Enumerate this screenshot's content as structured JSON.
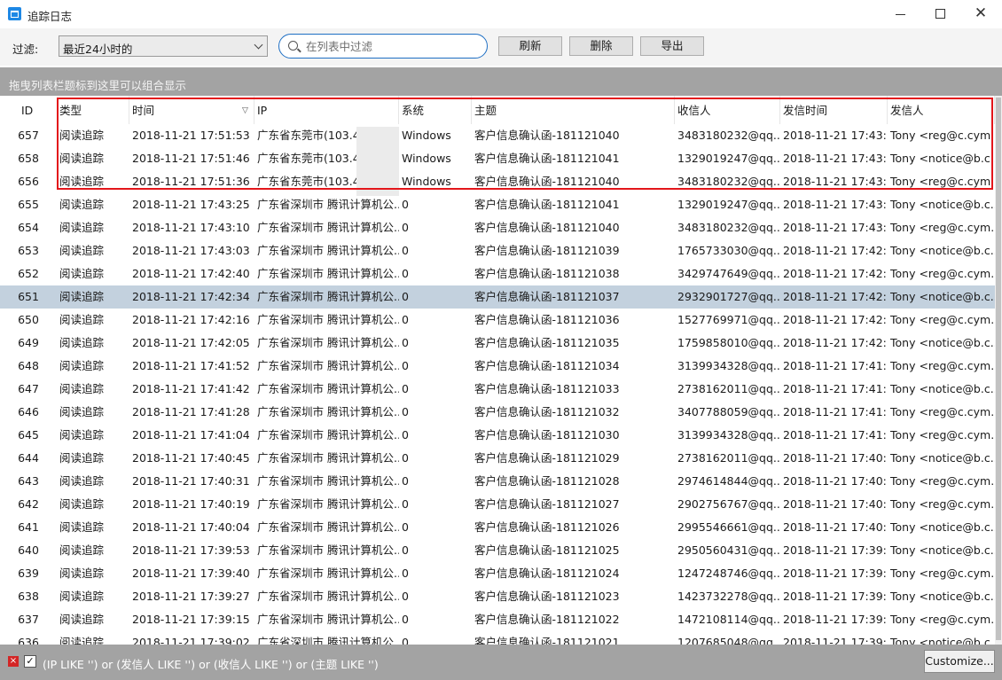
{
  "window": {
    "title": "追踪日志",
    "minimize": "—",
    "maximize": "☐",
    "close": "✕"
  },
  "toolbar": {
    "filter_label": "过滤:",
    "filter_value": "最近24小时的",
    "search_placeholder": "在列表中过滤",
    "refresh": "刷新",
    "delete": "删除",
    "export": "导出"
  },
  "group_panel": {
    "hint": "拖曳列表栏题标到这里可以组合显示"
  },
  "columns": {
    "id": "ID",
    "type": "类型",
    "time": "时间",
    "ip": "IP",
    "system": "系统",
    "subject": "主题",
    "recipient": "收信人",
    "send_time": "发信时间",
    "sender": "发信人"
  },
  "sort_indicator": "▽",
  "selected_row_id": "651",
  "rows": [
    {
      "id": "657",
      "type": "阅读追踪",
      "time": "2018-11-21 17:51:53",
      "ip": "广东省东莞市(103.45",
      "system": "Windows",
      "subject": "客户信息确认函-181121040",
      "recipient": "3483180232@qq....",
      "send_time": "2018-11-21 17:43:...",
      "sender": "Tony <reg@c.cym..."
    },
    {
      "id": "658",
      "type": "阅读追踪",
      "time": "2018-11-21 17:51:46",
      "ip": "广东省东莞市(103.45",
      "system": "Windows",
      "subject": "客户信息确认函-181121041",
      "recipient": "1329019247@qq....",
      "send_time": "2018-11-21 17:43:...",
      "sender": "Tony <notice@b.c..."
    },
    {
      "id": "656",
      "type": "阅读追踪",
      "time": "2018-11-21 17:51:36",
      "ip": "广东省东莞市(103.45",
      "system": "Windows",
      "subject": "客户信息确认函-181121040",
      "recipient": "3483180232@qq....",
      "send_time": "2018-11-21 17:43:...",
      "sender": "Tony <reg@c.cym..."
    },
    {
      "id": "655",
      "type": "阅读追踪",
      "time": "2018-11-21 17:43:25",
      "ip": "广东省深圳市 腾讯计算机公...",
      "system": "0",
      "subject": "客户信息确认函-181121041",
      "recipient": "1329019247@qq....",
      "send_time": "2018-11-21 17:43:...",
      "sender": "Tony <notice@b.c..."
    },
    {
      "id": "654",
      "type": "阅读追踪",
      "time": "2018-11-21 17:43:10",
      "ip": "广东省深圳市 腾讯计算机公...",
      "system": "0",
      "subject": "客户信息确认函-181121040",
      "recipient": "3483180232@qq....",
      "send_time": "2018-11-21 17:43:...",
      "sender": "Tony <reg@c.cym..."
    },
    {
      "id": "653",
      "type": "阅读追踪",
      "time": "2018-11-21 17:43:03",
      "ip": "广东省深圳市 腾讯计算机公...",
      "system": "0",
      "subject": "客户信息确认函-181121039",
      "recipient": "1765733030@qq....",
      "send_time": "2018-11-21 17:42:...",
      "sender": "Tony <notice@b.c..."
    },
    {
      "id": "652",
      "type": "阅读追踪",
      "time": "2018-11-21 17:42:40",
      "ip": "广东省深圳市 腾讯计算机公...",
      "system": "0",
      "subject": "客户信息确认函-181121038",
      "recipient": "3429747649@qq....",
      "send_time": "2018-11-21 17:42:...",
      "sender": "Tony <reg@c.cym..."
    },
    {
      "id": "651",
      "type": "阅读追踪",
      "time": "2018-11-21 17:42:34",
      "ip": "广东省深圳市 腾讯计算机公...",
      "system": "0",
      "subject": "客户信息确认函-181121037",
      "recipient": "2932901727@qq....",
      "send_time": "2018-11-21 17:42:...",
      "sender": "Tony <notice@b.c..."
    },
    {
      "id": "650",
      "type": "阅读追踪",
      "time": "2018-11-21 17:42:16",
      "ip": "广东省深圳市 腾讯计算机公...",
      "system": "0",
      "subject": "客户信息确认函-181121036",
      "recipient": "1527769971@qq....",
      "send_time": "2018-11-21 17:42:...",
      "sender": "Tony <reg@c.cym..."
    },
    {
      "id": "649",
      "type": "阅读追踪",
      "time": "2018-11-21 17:42:05",
      "ip": "广东省深圳市 腾讯计算机公...",
      "system": "0",
      "subject": "客户信息确认函-181121035",
      "recipient": "1759858010@qq....",
      "send_time": "2018-11-21 17:42:...",
      "sender": "Tony <notice@b.c..."
    },
    {
      "id": "648",
      "type": "阅读追踪",
      "time": "2018-11-21 17:41:52",
      "ip": "广东省深圳市 腾讯计算机公...",
      "system": "0",
      "subject": "客户信息确认函-181121034",
      "recipient": "3139934328@qq....",
      "send_time": "2018-11-21 17:41:...",
      "sender": "Tony <reg@c.cym..."
    },
    {
      "id": "647",
      "type": "阅读追踪",
      "time": "2018-11-21 17:41:42",
      "ip": "广东省深圳市 腾讯计算机公...",
      "system": "0",
      "subject": "客户信息确认函-181121033",
      "recipient": "2738162011@qq....",
      "send_time": "2018-11-21 17:41:...",
      "sender": "Tony <notice@b.c..."
    },
    {
      "id": "646",
      "type": "阅读追踪",
      "time": "2018-11-21 17:41:28",
      "ip": "广东省深圳市 腾讯计算机公...",
      "system": "0",
      "subject": "客户信息确认函-181121032",
      "recipient": "3407788059@qq....",
      "send_time": "2018-11-21 17:41:...",
      "sender": "Tony <reg@c.cym..."
    },
    {
      "id": "645",
      "type": "阅读追踪",
      "time": "2018-11-21 17:41:04",
      "ip": "广东省深圳市 腾讯计算机公...",
      "system": "0",
      "subject": "客户信息确认函-181121030",
      "recipient": "3139934328@qq....",
      "send_time": "2018-11-21 17:41:...",
      "sender": "Tony <reg@c.cym..."
    },
    {
      "id": "644",
      "type": "阅读追踪",
      "time": "2018-11-21 17:40:45",
      "ip": "广东省深圳市 腾讯计算机公...",
      "system": "0",
      "subject": "客户信息确认函-181121029",
      "recipient": "2738162011@qq....",
      "send_time": "2018-11-21 17:40:...",
      "sender": "Tony <notice@b.c..."
    },
    {
      "id": "643",
      "type": "阅读追踪",
      "time": "2018-11-21 17:40:31",
      "ip": "广东省深圳市 腾讯计算机公...",
      "system": "0",
      "subject": "客户信息确认函-181121028",
      "recipient": "2974614844@qq....",
      "send_time": "2018-11-21 17:40:...",
      "sender": "Tony <reg@c.cym..."
    },
    {
      "id": "642",
      "type": "阅读追踪",
      "time": "2018-11-21 17:40:19",
      "ip": "广东省深圳市 腾讯计算机公...",
      "system": "0",
      "subject": "客户信息确认函-181121027",
      "recipient": "2902756767@qq....",
      "send_time": "2018-11-21 17:40:...",
      "sender": "Tony <reg@c.cym..."
    },
    {
      "id": "641",
      "type": "阅读追踪",
      "time": "2018-11-21 17:40:04",
      "ip": "广东省深圳市 腾讯计算机公...",
      "system": "0",
      "subject": "客户信息确认函-181121026",
      "recipient": "2995546661@qq....",
      "send_time": "2018-11-21 17:40:...",
      "sender": "Tony <notice@b.c..."
    },
    {
      "id": "640",
      "type": "阅读追踪",
      "time": "2018-11-21 17:39:53",
      "ip": "广东省深圳市 腾讯计算机公...",
      "system": "0",
      "subject": "客户信息确认函-181121025",
      "recipient": "2950560431@qq....",
      "send_time": "2018-11-21 17:39:...",
      "sender": "Tony <notice@b.c..."
    },
    {
      "id": "639",
      "type": "阅读追踪",
      "time": "2018-11-21 17:39:40",
      "ip": "广东省深圳市 腾讯计算机公...",
      "system": "0",
      "subject": "客户信息确认函-181121024",
      "recipient": "1247248746@qq....",
      "send_time": "2018-11-21 17:39:...",
      "sender": "Tony <reg@c.cym..."
    },
    {
      "id": "638",
      "type": "阅读追踪",
      "time": "2018-11-21 17:39:27",
      "ip": "广东省深圳市 腾讯计算机公...",
      "system": "0",
      "subject": "客户信息确认函-181121023",
      "recipient": "1423732278@qq....",
      "send_time": "2018-11-21 17:39:...",
      "sender": "Tony <notice@b.c..."
    },
    {
      "id": "637",
      "type": "阅读追踪",
      "time": "2018-11-21 17:39:15",
      "ip": "广东省深圳市 腾讯计算机公...",
      "system": "0",
      "subject": "客户信息确认函-181121022",
      "recipient": "1472108114@qq....",
      "send_time": "2018-11-21 17:39:...",
      "sender": "Tony <reg@c.cym..."
    },
    {
      "id": "636",
      "type": "阅读追踪",
      "time": "2018-11-21 17:39:02",
      "ip": "广东省深圳市 腾讯计算机公...",
      "system": "0",
      "subject": "客户信息确认函-181121021",
      "recipient": "1207685048@qq....",
      "send_time": "2018-11-21 17:39:...",
      "sender": "Tony <notice@b.c..."
    }
  ],
  "statusbar": {
    "clear_icon": "×",
    "check_icon": "✓",
    "filter_expression": "(IP LIKE '') or (发信人 LIKE '') or (收信人 LIKE '') or (主题 LIKE '')",
    "customize": "Customize..."
  }
}
